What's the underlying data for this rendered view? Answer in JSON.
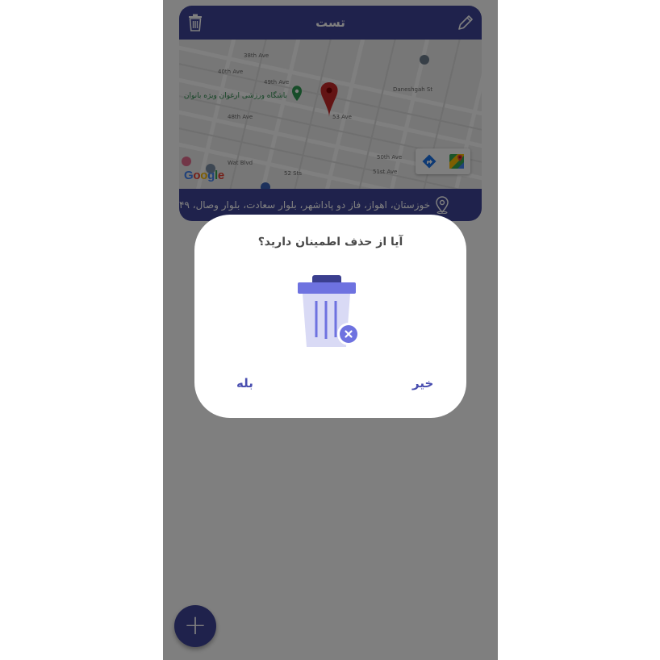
{
  "card": {
    "title": "تست",
    "address": "خوزستان، اهواز، فاز دو پاداشهر، بلوار سعادت، بلوار وصال، ۴۹",
    "map": {
      "streets": [
        "38th Ave",
        "40th Ave",
        "49th Ave",
        "48th Ave",
        "50th Ave",
        "51st Ave",
        "53 Ave",
        "52 Sts",
        "Wat Blvd",
        "Daneshgah St"
      ],
      "poi_name": "باشگاه ورزشی ارغوان ویژه بانوان",
      "google_logo": "Google"
    }
  },
  "dialog": {
    "title": "آیا از حذف اطمینان دارید؟",
    "no_label": "خیر",
    "yes_label": "بله"
  },
  "colors": {
    "primary": "#3f4499",
    "accent": "#4a4fb0",
    "trash_body": "#d9daf5",
    "trash_lid": "#6e72e0",
    "trash_handle": "#3b3f8f",
    "pin": "#d32f2f",
    "poi": "#2e9b52"
  },
  "icons": {
    "delete": "trash-icon",
    "edit": "pencil-icon",
    "location": "location-pin-icon",
    "add": "plus-icon"
  }
}
